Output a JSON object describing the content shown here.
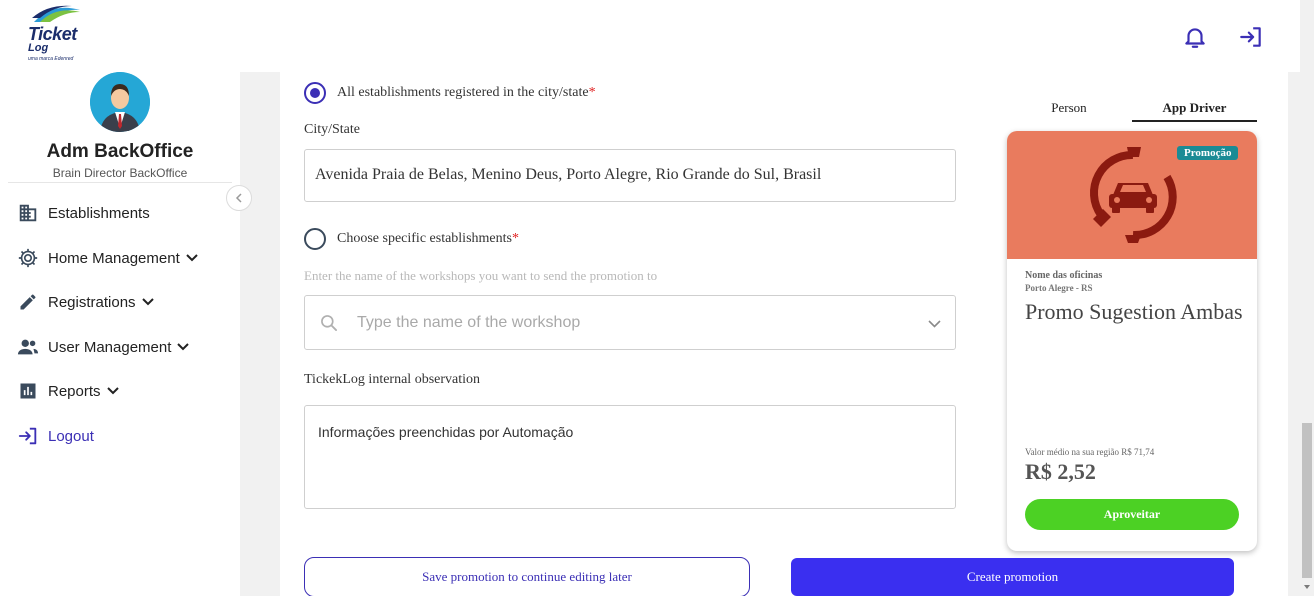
{
  "brand": {
    "logo_word1": "Ticket",
    "logo_word2": "Log",
    "logo_tagline": "uma marca Edenred",
    "accent": "#3b2fb5",
    "primary_button": "#3a2ff0"
  },
  "header": {
    "icons": [
      "bell-icon",
      "exit-icon"
    ]
  },
  "profile": {
    "name": "Adm BackOffice",
    "role": "Brain Director BackOffice"
  },
  "sidebar": {
    "items": [
      {
        "label": "Establishments",
        "icon": "building-icon"
      },
      {
        "label": "Home Management",
        "icon": "gear-icon"
      },
      {
        "label": "Registrations",
        "icon": "pencil-icon"
      },
      {
        "label": "User Management",
        "icon": "users-icon"
      },
      {
        "label": "Reports",
        "icon": "chart-icon"
      },
      {
        "label": "Logout",
        "icon": "logout-icon"
      }
    ]
  },
  "form": {
    "option_all_label": "All establishments registered in the city/state",
    "required_mark": "*",
    "city_state_label": "City/State",
    "city_state_value": "Avenida Praia de Belas, Menino Deus, Porto Alegre, Rio Grande do Sul, Brasil",
    "option_specific_label": "Choose specific establishments",
    "workshop_hint": "Enter the name of the workshops you want to send the promotion to",
    "workshop_placeholder": "Type the name of the workshop",
    "observation_label": "TickekLog internal observation",
    "observation_value": "Informações preenchidas por Automação",
    "save_later_label": "Save promotion to continue editing later",
    "create_label": "Create promotion"
  },
  "preview": {
    "tabs": [
      {
        "label": "Person",
        "active": false
      },
      {
        "label": "App Driver",
        "active": true
      }
    ],
    "card": {
      "badge": "Promoção",
      "banner_color": "#e97b5e",
      "shop_name": "Nome das oficinas",
      "shop_location": "Porto Alegre - RS",
      "title": "Promo Sugestion Ambas",
      "average_price": "Valor médio na sua região R$ 71,74",
      "price": "R$ 2,52",
      "cta": "Aproveitar"
    }
  }
}
